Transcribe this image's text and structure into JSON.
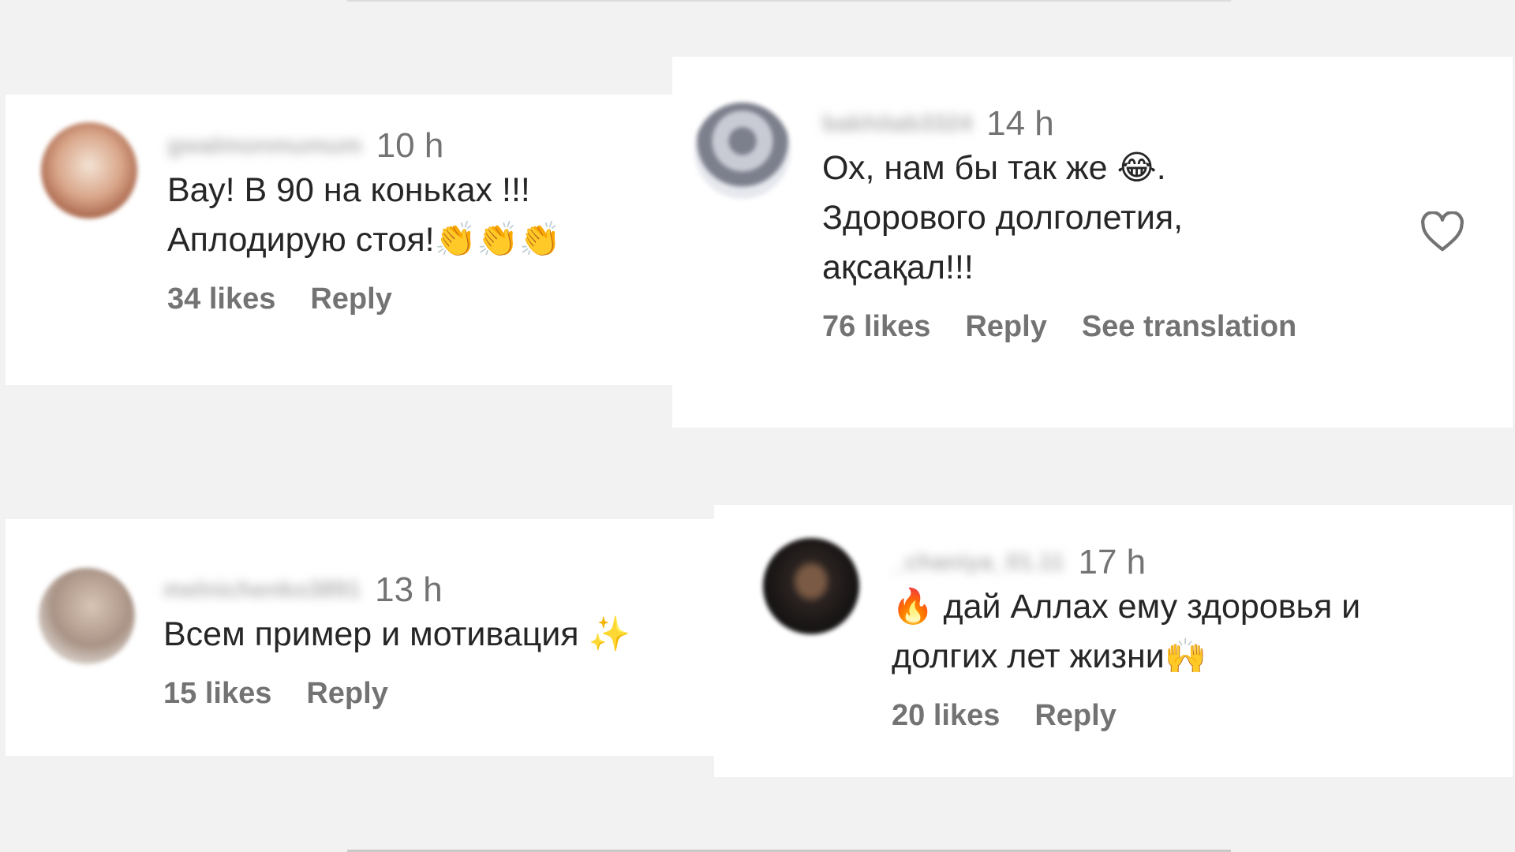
{
  "comments": [
    {
      "username": "gwalmonmumum",
      "time": "10 h",
      "text": "Вау! В 90 на коньках !!!\nАплодирую стоя!👏👏👏",
      "likes": "34 likes",
      "reply": "Reply"
    },
    {
      "username": "bakhitab3324",
      "time": "14 h",
      "text": "Ох, нам бы так же 😂.\nЗдорового долголетия,\nақсақал!!!",
      "likes": "76 likes",
      "reply": "Reply",
      "translation": "See translation",
      "like_icon": "heart-outline-icon"
    },
    {
      "username": "melnichenko3891",
      "time": "13 h",
      "text": "Всем пример и мотивация ✨",
      "likes": "15 likes",
      "reply": "Reply"
    },
    {
      "username": "_chaniya_01.11",
      "time": "17 h",
      "text": "🔥 дай Аллах ему здоровья и\nдолгих лет жизни🙌",
      "likes": "20 likes",
      "reply": "Reply"
    }
  ],
  "colors": {
    "background": "#f2f2f2",
    "card": "#ffffff",
    "text": "#262626",
    "muted": "#737373"
  }
}
